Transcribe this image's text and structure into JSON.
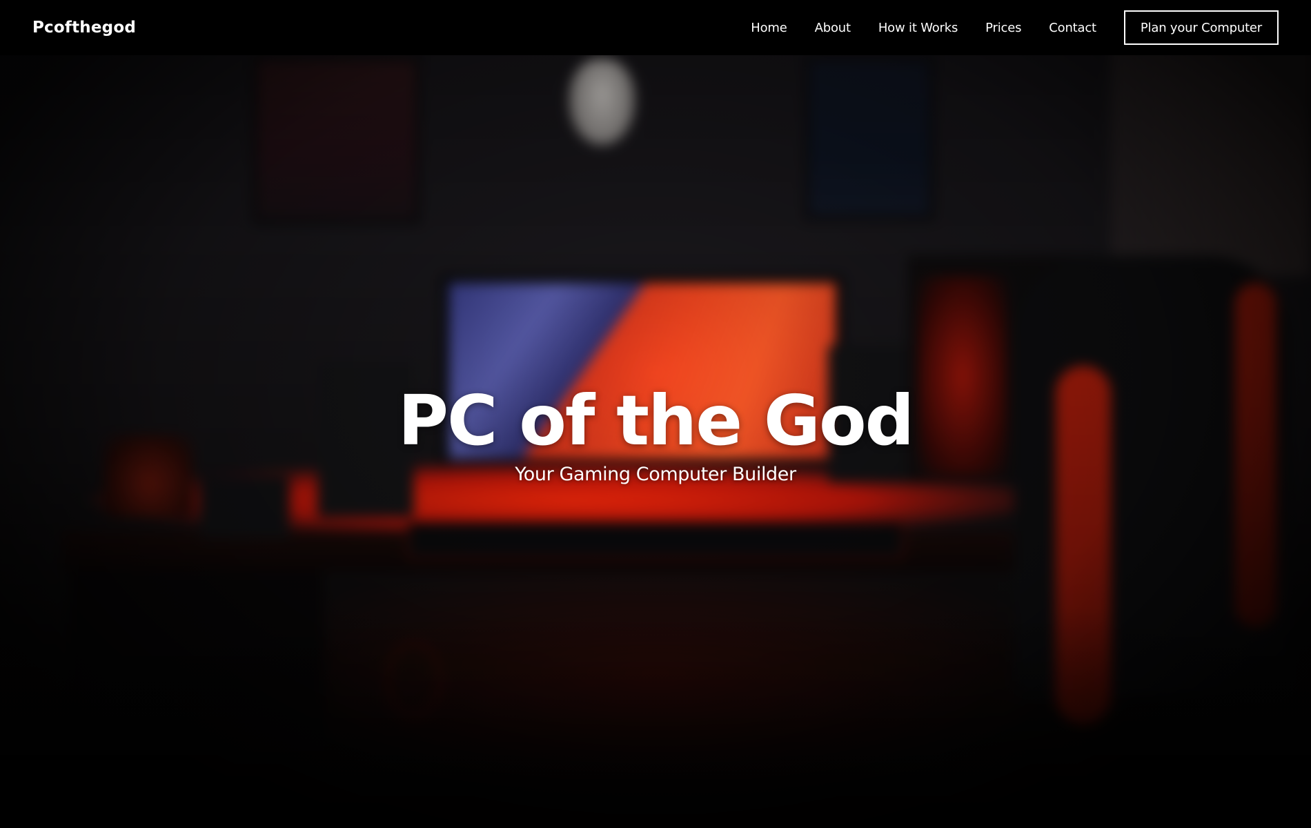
{
  "brand": {
    "name": "Pcofthegod"
  },
  "nav": {
    "links": [
      {
        "label": "Home"
      },
      {
        "label": "About"
      },
      {
        "label": "How it Works"
      },
      {
        "label": "Prices"
      },
      {
        "label": "Contact"
      }
    ],
    "cta_label": "Plan your Computer"
  },
  "hero": {
    "title": "PC of the God",
    "subtitle": "Your Gaming Computer Builder",
    "background": "blurred-gaming-room-photo"
  },
  "colors": {
    "navbar_bg": "#000000",
    "text": "#ffffff",
    "accent_red": "#e8220a",
    "monitor_blue": "#4b4fa8"
  }
}
